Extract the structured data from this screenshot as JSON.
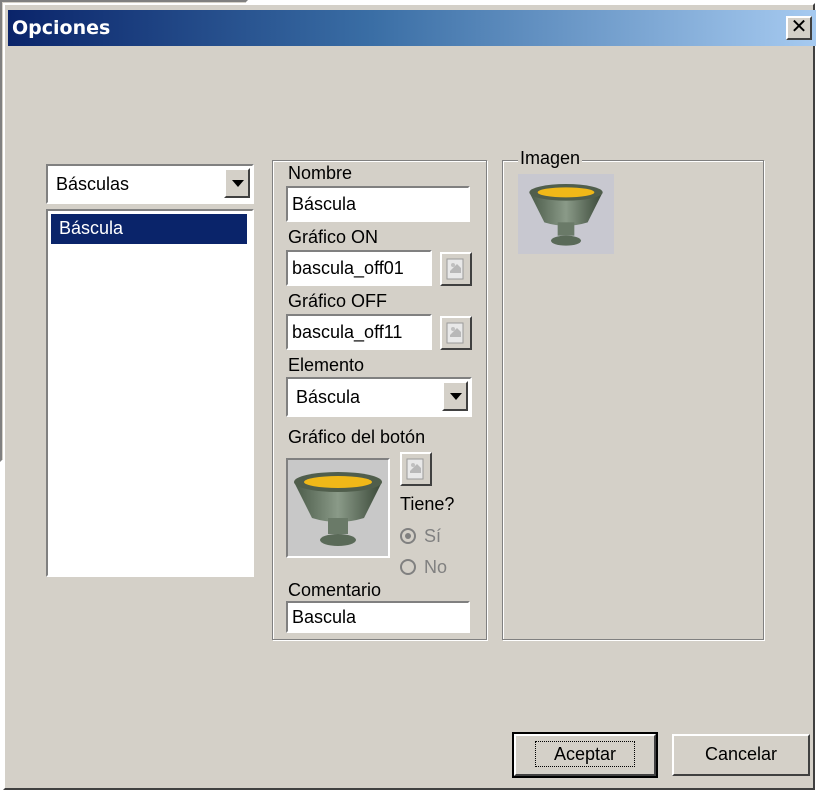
{
  "window": {
    "title": "Opciones",
    "close_label": "✕"
  },
  "category_combo": {
    "value": "Básculas"
  },
  "item_list": {
    "items": [
      "Báscula"
    ],
    "selected": "Báscula"
  },
  "properties": {
    "nombre_label": "Nombre",
    "nombre_value": "Báscula",
    "grafico_on_label": "Gráfico ON",
    "grafico_on_value": "bascula_off01",
    "grafico_off_label": "Gráfico OFF",
    "grafico_off_value": "bascula_off11",
    "elemento_label": "Elemento",
    "elemento_value": "Báscula",
    "grafico_boton_label": "Gráfico del botón",
    "tiene_label": "Tiene?",
    "si_label": "Sí",
    "no_label": "No",
    "comentario_label": "Comentario",
    "comentario_value": "Bascula"
  },
  "imagen_group": {
    "label": "Imagen"
  },
  "buttons": {
    "accept": "Aceptar",
    "cancel": "Cancelar"
  },
  "colors": {
    "title_start": "#0a246a",
    "title_end": "#a6caf0",
    "selection": "#0a246a",
    "face": "#d4d0c8"
  }
}
